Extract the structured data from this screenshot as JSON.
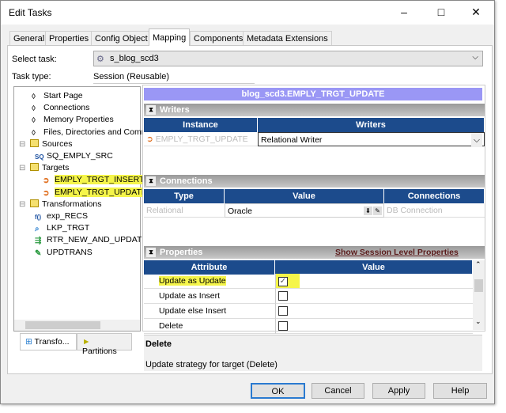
{
  "window": {
    "title": "Edit Tasks",
    "minimize": "–",
    "maximize": "□",
    "close": "✕"
  },
  "tabs": [
    "General",
    "Properties",
    "Config Object",
    "Mapping",
    "Components",
    "Metadata Extensions"
  ],
  "active_tab": "Mapping",
  "select_task": {
    "label": "Select task:",
    "value": "s_blog_scd3"
  },
  "task_type": {
    "label": "Task type:",
    "value": "Session (Reusable)"
  },
  "tree": {
    "items": [
      {
        "label": "Start Page",
        "icon": "diamond-icon"
      },
      {
        "label": "Connections",
        "icon": "diamond-icon"
      },
      {
        "label": "Memory Properties",
        "icon": "diamond-icon"
      },
      {
        "label": "Files, Directories and Commands",
        "icon": "diamond-icon"
      },
      {
        "label": "Sources",
        "icon": "folder-icon"
      },
      {
        "label": "SQ_EMPLY_SRC",
        "icon": "source-qualifier-icon"
      },
      {
        "label": "Targets",
        "icon": "folder-icon"
      },
      {
        "label": "EMPLY_TRGT_INSERT",
        "icon": "target-icon",
        "highlighted": true
      },
      {
        "label": "EMPLY_TRGT_UPDATE",
        "icon": "target-icon",
        "highlighted": true,
        "selected": true
      },
      {
        "label": "Transformations",
        "icon": "folder-icon"
      },
      {
        "label": "exp_RECS",
        "icon": "expression-icon"
      },
      {
        "label": "LKP_TRGT",
        "icon": "lookup-icon"
      },
      {
        "label": "RTR_NEW_AND_UPDATE",
        "icon": "router-icon"
      },
      {
        "label": "UPDTRANS",
        "icon": "update-strategy-icon"
      }
    ],
    "bottom_tabs": [
      "Transfo...",
      "Partitions"
    ]
  },
  "detail": {
    "header": "blog_scd3.EMPLY_TRGT_UPDATE",
    "writers": {
      "title": "Writers",
      "columns": [
        "Instance",
        "Writers"
      ],
      "row": {
        "instance": "EMPLY_TRGT_UPDATE",
        "writer": "Relational Writer"
      }
    },
    "connections": {
      "title": "Connections",
      "columns": [
        "Type",
        "Value",
        "Connections"
      ],
      "row": {
        "type": "Relational",
        "value": "Oracle",
        "connection": "DB Connection"
      }
    },
    "properties": {
      "title": "Properties",
      "link": "Show Session Level Properties",
      "columns": [
        "Attribute",
        "Value"
      ],
      "rows": [
        {
          "attribute": "Update as Update",
          "checked": true,
          "highlighted": true
        },
        {
          "attribute": "Update as Insert",
          "checked": false
        },
        {
          "attribute": "Update else Insert",
          "checked": false
        },
        {
          "attribute": "Delete",
          "checked": false
        }
      ]
    },
    "description": {
      "title": "Delete",
      "text": "Update strategy for target (Delete)"
    }
  },
  "buttons": {
    "ok": "OK",
    "cancel": "Cancel",
    "apply": "Apply",
    "help": "Help"
  },
  "colors": {
    "header_purple": "#9a97f5",
    "table_header": "#1c4b8c",
    "highlight": "#f5f54a"
  }
}
